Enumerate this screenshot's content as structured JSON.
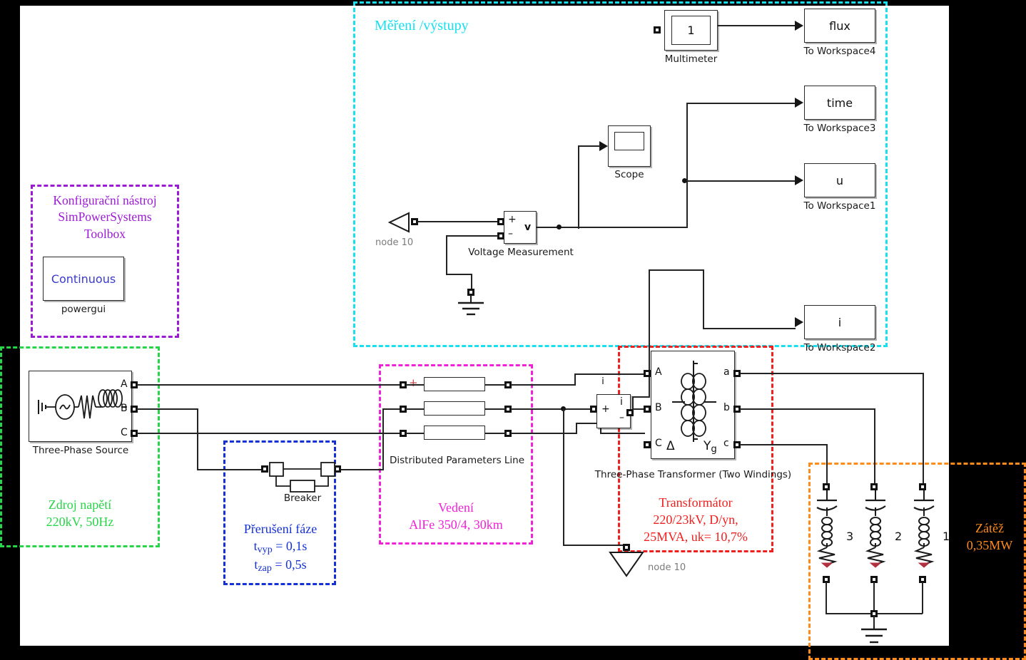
{
  "diagram": {
    "title": "Simulink SimPowerSystems power system model",
    "canvas_bg": "#ffffff",
    "page_bg": "#000000"
  },
  "groups": {
    "measurement": {
      "label": "Měření /výstupy",
      "color": "#18e0ee"
    },
    "powergui": {
      "line1": "Konfigurační nástroj",
      "line2": "SimPowerSystems",
      "line3": "Toolbox",
      "color": "#9c1ad6"
    },
    "source": {
      "line1": "Zdroj napětí",
      "line2": "220kV, 50Hz",
      "color": "#28d449"
    },
    "breaker": {
      "line1": "Přerušení fáze",
      "line2_a": "t",
      "line2_sub": "vyp",
      "line2_b": " = 0,1s",
      "line3_a": "t",
      "line3_sub": "zap",
      "line3_b": " = 0,5s",
      "color": "#1530d6"
    },
    "line": {
      "line1": "Vedení",
      "line2": "AlFe 350/4, 30km",
      "color": "#f021d6"
    },
    "transformer": {
      "line1": "Transformátor",
      "line2": "220/23kV, D/yn,",
      "line3": "25MVA, uk= 10,7%",
      "color": "#f02020"
    },
    "load": {
      "line1": "Zátěž",
      "line2": "0,35MW",
      "color": "#ff8c1a"
    }
  },
  "blocks": {
    "multimeter": {
      "value": "1",
      "label": "Multimeter"
    },
    "to_workspace4": {
      "value": "flux",
      "label": "To Workspace4"
    },
    "to_workspace3": {
      "value": "time",
      "label": "To Workspace3"
    },
    "to_workspace1": {
      "value": "u",
      "label": "To Workspace1"
    },
    "to_workspace2": {
      "value": "i",
      "label": "To Workspace2"
    },
    "scope": {
      "label": "Scope"
    },
    "powergui_block": {
      "value": "Continuous",
      "label": "powergui",
      "text_color": "#3a3ad0"
    },
    "voltage_meas": {
      "label": "Voltage Measurement",
      "plus": "+",
      "minus": "–",
      "out": "v"
    },
    "current_meas": {
      "label": "i",
      "plus": "+",
      "minus": "–",
      "out": "i"
    },
    "three_phase_source": {
      "label": "Three-Phase Source",
      "ports": [
        "A",
        "B",
        "C"
      ]
    },
    "breaker_block": {
      "label": "Breaker"
    },
    "dist_line": {
      "label": "Distributed Parameters Line",
      "plus_marker": "+"
    },
    "transformer_block": {
      "label": "Three-Phase Transformer (Two Windings)",
      "in_ports": [
        "A",
        "B",
        "C"
      ],
      "out_ports": [
        "a",
        "b",
        "c"
      ],
      "winding_primary": "Δ",
      "winding_secondary_a": "Y",
      "winding_secondary_b": "g"
    },
    "goto_tag_left": {
      "label": "node 10"
    },
    "goto_tag_bottom": {
      "label": "node 10"
    },
    "load_branches": {
      "labels": [
        "3",
        "2",
        "1"
      ]
    }
  }
}
